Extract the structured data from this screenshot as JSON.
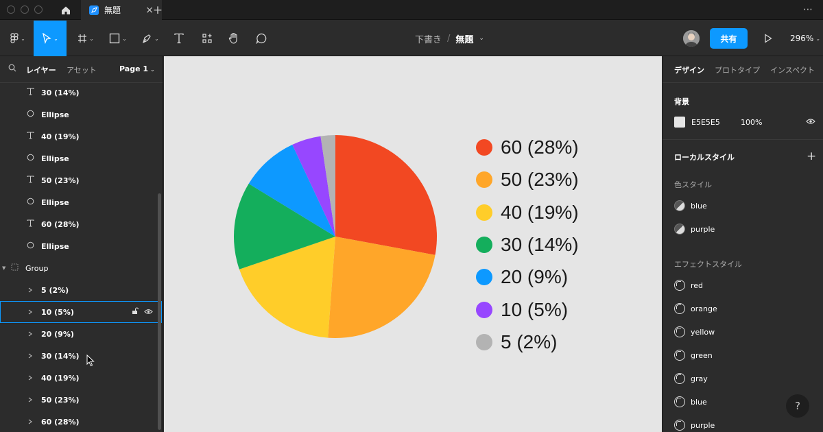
{
  "tab": {
    "title": "無題"
  },
  "breadcrumb": {
    "drafts": "下書き",
    "separator": "/",
    "file": "無題"
  },
  "toolbar": {
    "share_label": "共有",
    "zoom": "296%"
  },
  "left_panel": {
    "tabs": {
      "layers": "レイヤー",
      "assets": "アセット"
    },
    "page": "Page 1",
    "layers": [
      {
        "name": "30 (14%)",
        "icon": "text-icon"
      },
      {
        "name": "Ellipse",
        "icon": "ellipse-icon"
      },
      {
        "name": "40 (19%)",
        "icon": "text-icon"
      },
      {
        "name": "Ellipse",
        "icon": "ellipse-icon"
      },
      {
        "name": "50 (23%)",
        "icon": "text-icon"
      },
      {
        "name": "Ellipse",
        "icon": "ellipse-icon"
      },
      {
        "name": "60 (28%)",
        "icon": "text-icon"
      },
      {
        "name": "Ellipse",
        "icon": "ellipse-icon"
      },
      {
        "name": "Group",
        "icon": "group-icon"
      },
      {
        "name": "5 (2%)",
        "icon": "slice-icon"
      },
      {
        "name": "10 (5%)",
        "icon": "slice-icon"
      },
      {
        "name": "20 (9%)",
        "icon": "slice-icon"
      },
      {
        "name": "30 (14%)",
        "icon": "slice-icon"
      },
      {
        "name": "40 (19%)",
        "icon": "slice-icon"
      },
      {
        "name": "50 (23%)",
        "icon": "slice-icon"
      },
      {
        "name": "60 (28%)",
        "icon": "slice-icon"
      }
    ]
  },
  "right_panel": {
    "tabs": {
      "design": "デザイン",
      "prototype": "プロトタイプ",
      "inspect": "インスペクト"
    },
    "background": {
      "title": "背景",
      "hex": "E5E5E5",
      "opacity": "100%"
    },
    "local_styles": {
      "title": "ローカルスタイル"
    },
    "color_styles": {
      "title": "色スタイル",
      "items": [
        "blue",
        "purple"
      ]
    },
    "effect_styles": {
      "title": "エフェクトスタイル",
      "items": [
        "red",
        "orange",
        "yellow",
        "green",
        "gray",
        "blue",
        "purple"
      ]
    },
    "help": "?"
  },
  "chart_data": {
    "type": "pie",
    "title": "",
    "slices": [
      {
        "label": "60 (28%)",
        "value": 60,
        "color": "#f24822"
      },
      {
        "label": "50 (23%)",
        "value": 50,
        "color": "#ffa629"
      },
      {
        "label": "40 (19%)",
        "value": 40,
        "color": "#ffcd29"
      },
      {
        "label": "30 (14%)",
        "value": 30,
        "color": "#14ae5c"
      },
      {
        "label": "20 (9%)",
        "value": 20,
        "color": "#0d99ff"
      },
      {
        "label": "10 (5%)",
        "value": 10,
        "color": "#9747ff"
      },
      {
        "label": "5 (2%)",
        "value": 5,
        "color": "#b3b3b3"
      }
    ]
  }
}
